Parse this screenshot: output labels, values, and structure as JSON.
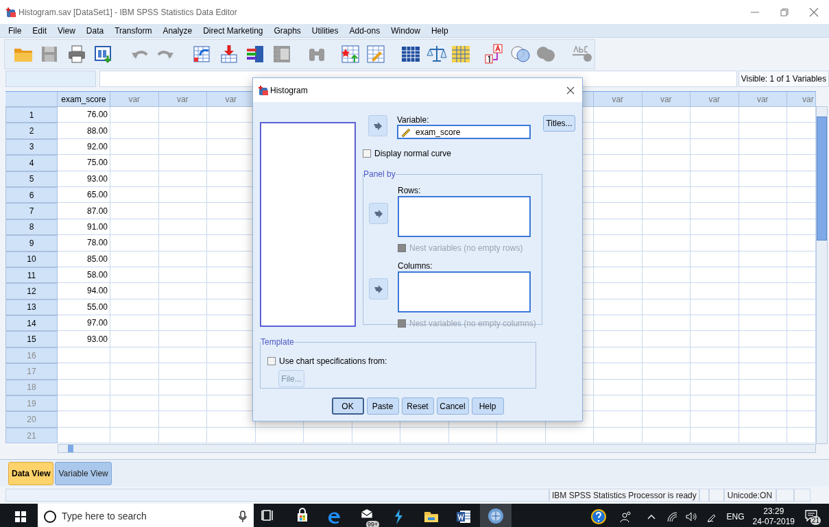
{
  "window": {
    "title": "Histogram.sav [DataSet1] - IBM SPSS Statistics Data Editor"
  },
  "menu": [
    "File",
    "Edit",
    "View",
    "Data",
    "Transform",
    "Analyze",
    "Direct Marketing",
    "Graphs",
    "Utilities",
    "Add-ons",
    "Window",
    "Help"
  ],
  "toolbar": [
    {
      "kind": "folder",
      "disabled": false
    },
    {
      "kind": "floppy",
      "disabled": true
    },
    {
      "kind": "printer",
      "disabled": false
    },
    {
      "kind": "window",
      "disabled": false
    },
    {
      "kind": "undo",
      "disabled": true
    },
    {
      "kind": "redo",
      "disabled": true
    },
    {
      "kind": "table-arrow",
      "disabled": false
    },
    {
      "kind": "table-down",
      "disabled": false
    },
    {
      "kind": "bars",
      "disabled": false
    },
    {
      "kind": "mu-table",
      "disabled": true
    },
    {
      "kind": "binoculars",
      "disabled": true
    },
    {
      "kind": "star-table",
      "disabled": false
    },
    {
      "kind": "pencil-table",
      "disabled": false
    },
    {
      "kind": "grid",
      "disabled": false
    },
    {
      "kind": "scale",
      "disabled": false
    },
    {
      "kind": "yellow-grid",
      "disabled": false
    },
    {
      "kind": "a1",
      "disabled": false
    },
    {
      "kind": "circles",
      "disabled": false
    },
    {
      "kind": "venn",
      "disabled": true
    },
    {
      "kind": "spellcheck",
      "disabled": true
    }
  ],
  "visible_label": "Visible: 1 of 1 Variables",
  "grid": {
    "columns_left": [
      "exam_score",
      "var",
      "var",
      "var"
    ],
    "columns_right": [
      "var",
      "var",
      "var",
      "var",
      "var"
    ],
    "rows": [
      {
        "number": "1",
        "value": "76.00"
      },
      {
        "number": "2",
        "value": "88.00"
      },
      {
        "number": "3",
        "value": "92.00"
      },
      {
        "number": "4",
        "value": "75.00"
      },
      {
        "number": "5",
        "value": "93.00"
      },
      {
        "number": "6",
        "value": "65.00"
      },
      {
        "number": "7",
        "value": "87.00"
      },
      {
        "number": "8",
        "value": "91.00"
      },
      {
        "number": "9",
        "value": "78.00"
      },
      {
        "number": "10",
        "value": "85.00"
      },
      {
        "number": "11",
        "value": "58.00"
      },
      {
        "number": "12",
        "value": "94.00"
      },
      {
        "number": "13",
        "value": "55.00"
      },
      {
        "number": "14",
        "value": "97.00"
      },
      {
        "number": "15",
        "value": "93.00"
      },
      {
        "number": "16"
      },
      {
        "number": "17"
      },
      {
        "number": "18"
      },
      {
        "number": "19"
      },
      {
        "number": "20"
      },
      {
        "number": "21"
      }
    ]
  },
  "view_tabs": [
    {
      "label": "Data View",
      "selected": true
    },
    {
      "label": "Variable View",
      "selected": false
    }
  ],
  "status_bar": {
    "processor": "IBM SPSS Statistics Processor is ready",
    "unicode": "Unicode:ON"
  },
  "dialog": {
    "title": "Histogram",
    "variable_label": "Variable:",
    "variable_value": "exam_score",
    "titles_button": "Titles...",
    "normal_curve": {
      "label": "Display normal curve",
      "checked": false
    },
    "panel_by": {
      "title": "Panel by",
      "rows_label": "Rows:",
      "rows_nest": {
        "label": "Nest variables (no empty rows)",
        "checked": false,
        "disabled": true
      },
      "columns_label": "Columns:",
      "columns_nest": {
        "label": "Nest variables (no empty columns)",
        "checked": false,
        "disabled": true
      }
    },
    "template": {
      "title": "Template",
      "use_chart": {
        "label": "Use chart specifications from:",
        "checked": false
      },
      "file_button": {
        "label": "File...",
        "disabled": true
      }
    },
    "buttons": [
      {
        "label": "OK",
        "default": true
      },
      {
        "label": "Paste",
        "default": false
      },
      {
        "label": "Reset",
        "default": false
      },
      {
        "label": "Cancel",
        "default": false
      },
      {
        "label": "Help",
        "default": false
      }
    ]
  },
  "taskbar": {
    "search_placeholder": "Type here to search",
    "apps": [
      {
        "kind": "task-view",
        "selected": false
      },
      {
        "kind": "store",
        "selected": false
      },
      {
        "kind": "edge",
        "selected": false
      },
      {
        "kind": "mail",
        "badge": "99+",
        "selected": false
      },
      {
        "kind": "bolt",
        "selected": false
      },
      {
        "kind": "folder",
        "selected": false
      },
      {
        "kind": "word",
        "selected": false
      },
      {
        "kind": "spss",
        "selected": true
      }
    ],
    "language": "ENG",
    "time": "23:29",
    "date": "24-07-2019",
    "notifications": "21"
  }
}
